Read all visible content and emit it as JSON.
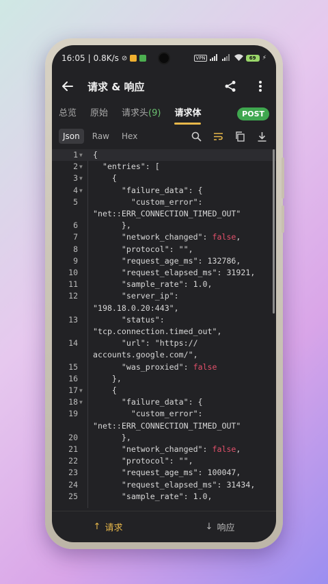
{
  "status_bar": {
    "time": "16:05",
    "speed": "0.8K/s",
    "vpn": "VPN",
    "battery": "69"
  },
  "app_bar": {
    "title": "请求 & 响应",
    "back_icon": "arrow-left-icon",
    "share_icon": "share-icon",
    "more_icon": "more-vert-icon"
  },
  "tabs": [
    {
      "label": "总览",
      "active": false
    },
    {
      "label": "原始",
      "active": false
    },
    {
      "label": "请求头",
      "count": "(9)",
      "active": false
    },
    {
      "label": "请求体",
      "active": true
    }
  ],
  "method_badge": "POST",
  "format": {
    "options": [
      "Json",
      "Raw",
      "Hex"
    ],
    "selected": "Json"
  },
  "code_lines": [
    {
      "n": "1",
      "fold": true,
      "t": "{"
    },
    {
      "n": "2",
      "fold": true,
      "t": "  \"entries\": ["
    },
    {
      "n": "3",
      "fold": true,
      "t": "    {"
    },
    {
      "n": "4",
      "fold": true,
      "t": "      \"failure_data\": {"
    },
    {
      "n": "5",
      "fold": false,
      "t": "        \"custom_error\":",
      "cont": "\"net::ERR_CONNECTION_TIMED_OUT\""
    },
    {
      "n": "6",
      "fold": false,
      "t": "      },"
    },
    {
      "n": "7",
      "fold": false,
      "t": "      \"network_changed\": ",
      "b": "false",
      "after": ","
    },
    {
      "n": "8",
      "fold": false,
      "t": "      \"protocol\": \"\","
    },
    {
      "n": "9",
      "fold": false,
      "t": "      \"request_age_ms\": 132786,"
    },
    {
      "n": "10",
      "fold": false,
      "t": "      \"request_elapsed_ms\": 31921,"
    },
    {
      "n": "11",
      "fold": false,
      "t": "      \"sample_rate\": 1.0,"
    },
    {
      "n": "12",
      "fold": false,
      "t": "      \"server_ip\":",
      "cont": "\"198.18.0.20:443\","
    },
    {
      "n": "13",
      "fold": false,
      "t": "      \"status\":",
      "cont": "\"tcp.connection.timed_out\","
    },
    {
      "n": "14",
      "fold": false,
      "t": "      \"url\": \"https://",
      "cont": "accounts.google.com/\","
    },
    {
      "n": "15",
      "fold": false,
      "t": "      \"was_proxied\": ",
      "b": "false",
      "after": ""
    },
    {
      "n": "16",
      "fold": false,
      "t": "    },"
    },
    {
      "n": "17",
      "fold": true,
      "t": "    {"
    },
    {
      "n": "18",
      "fold": true,
      "t": "      \"failure_data\": {"
    },
    {
      "n": "19",
      "fold": false,
      "t": "        \"custom_error\":",
      "cont": "\"net::ERR_CONNECTION_TIMED_OUT\""
    },
    {
      "n": "20",
      "fold": false,
      "t": "      },"
    },
    {
      "n": "21",
      "fold": false,
      "t": "      \"network_changed\": ",
      "b": "false",
      "after": ","
    },
    {
      "n": "22",
      "fold": false,
      "t": "      \"protocol\": \"\","
    },
    {
      "n": "23",
      "fold": false,
      "t": "      \"request_age_ms\": 100047,"
    },
    {
      "n": "24",
      "fold": false,
      "t": "      \"request_elapsed_ms\": 31434,"
    },
    {
      "n": "25",
      "fold": false,
      "t": "      \"sample_rate\": 1.0,"
    }
  ],
  "bottom_nav": {
    "request_label": "请求",
    "response_label": "响应"
  },
  "colors": {
    "accent": "#e8b84a",
    "post_badge": "#3fa74f",
    "bool": "#e0506a",
    "count": "#6cc070"
  }
}
